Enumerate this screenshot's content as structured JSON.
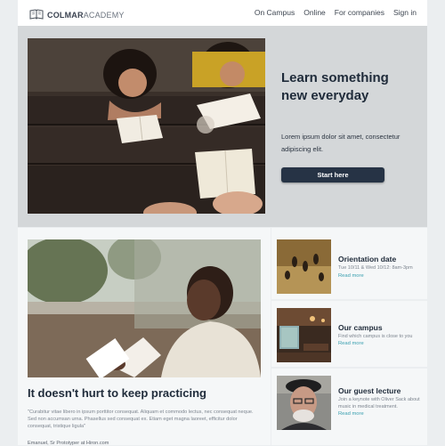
{
  "header": {
    "logo_bold": "COLMAR",
    "logo_light": "ACADEMY",
    "nav": [
      "On Campus",
      "Online",
      "For companies",
      "Sign in"
    ]
  },
  "hero": {
    "title": "Learn something new everyday",
    "subtitle": "Lorem ipsum dolor sit amet, consectetur adipiscing elit.",
    "button": "Start here"
  },
  "feature": {
    "title": "It doesn't hurt to keep practicing",
    "quote": "\"Curabitur vitae libero in ipsum porttitor consequat. Aliquam et commodo lectus, nec consequat neque. Sed non accumsan urna. Phasellus sed consequat ex. Etiam eget magna laoreet, efficitur dolor consequat, tristique ligula\"",
    "author": "Emanuel, Sr Prototyper at Hiron.com"
  },
  "cards": [
    {
      "title": "Orientation date",
      "text": "Tue 10/11 & Wed 10/12: 8am-3pm",
      "link": "Read more"
    },
    {
      "title": "Our campus",
      "text": "Find which campus is close to you",
      "link": "Read more"
    },
    {
      "title": "Our guest lecture",
      "text": "Join a keynote with Oliver Sack about music in medical treatment.",
      "link": "Read more"
    }
  ],
  "colors": {
    "page_bg": "#ebeef0",
    "hero_bg": "#d4d7d9",
    "button": "#263345",
    "link": "#3ba0b0"
  }
}
